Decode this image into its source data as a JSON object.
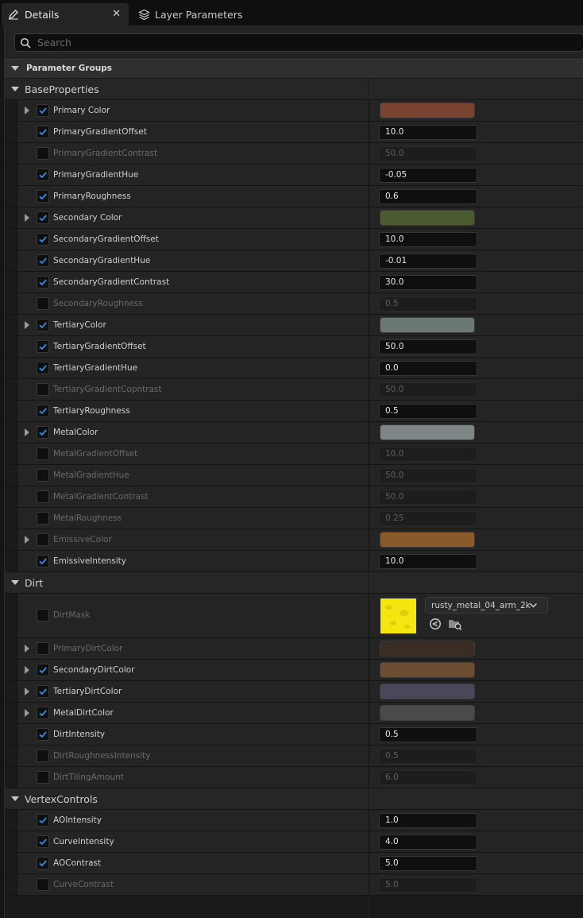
{
  "tabs": [
    {
      "label": "Details",
      "active": true,
      "icon": "pencil-icon"
    },
    {
      "label": "Layer Parameters",
      "active": false,
      "icon": "layers-icon"
    }
  ],
  "search": {
    "placeholder": "Search"
  },
  "parameter_groups_label": "Parameter Groups",
  "colors": {
    "check": "#2f8fe8",
    "enabled_text": "#cfcfcf",
    "disabled_text": "#6a6a6a"
  },
  "groups": [
    {
      "name": "BaseProperties",
      "params": [
        {
          "name": "Primary Color",
          "enabled": true,
          "expandable": true,
          "type": "color",
          "color": "#7a432f"
        },
        {
          "name": "PrimaryGradientOffset",
          "enabled": true,
          "type": "number",
          "value": "10.0"
        },
        {
          "name": "PrimaryGradientContrast",
          "enabled": false,
          "type": "number",
          "value": "50.0"
        },
        {
          "name": "PrimaryGradientHue",
          "enabled": true,
          "type": "number",
          "value": "-0.05"
        },
        {
          "name": "PrimaryRoughness",
          "enabled": true,
          "type": "number",
          "value": "0.6"
        },
        {
          "name": "Secondary Color",
          "enabled": true,
          "expandable": true,
          "type": "color",
          "color": "#4c5a2f"
        },
        {
          "name": "SecondaryGradientOffset",
          "enabled": true,
          "type": "number",
          "value": "10.0"
        },
        {
          "name": "SecondaryGradientHue",
          "enabled": true,
          "type": "number",
          "value": "-0.01"
        },
        {
          "name": "SecondaryGradientContrast",
          "enabled": true,
          "type": "number",
          "value": "30.0"
        },
        {
          "name": "SecondaryRoughness",
          "enabled": false,
          "type": "number",
          "value": "0.5"
        },
        {
          "name": "TertiaryColor",
          "enabled": true,
          "expandable": true,
          "type": "color",
          "color": "#6b7873"
        },
        {
          "name": "TertiaryGradientOffset",
          "enabled": true,
          "type": "number",
          "value": "50.0"
        },
        {
          "name": "TertiaryGradientHue",
          "enabled": true,
          "type": "number",
          "value": "0.0"
        },
        {
          "name": "TertiaryGradientCopntrast",
          "enabled": false,
          "type": "number",
          "value": "50.0"
        },
        {
          "name": "TertiaryRoughness",
          "enabled": true,
          "type": "number",
          "value": "0.5"
        },
        {
          "name": "MetalColor",
          "enabled": true,
          "expandable": true,
          "type": "color",
          "color": "#7e8687"
        },
        {
          "name": "MetalGradientOffset",
          "enabled": false,
          "type": "number",
          "value": "10.0"
        },
        {
          "name": "MetalGradientHue",
          "enabled": false,
          "type": "number",
          "value": "50.0"
        },
        {
          "name": "MetalGradientContrast",
          "enabled": false,
          "type": "number",
          "value": "50.0"
        },
        {
          "name": "MetalRoughness",
          "enabled": false,
          "type": "number",
          "value": "0.25"
        },
        {
          "name": "EmissiveColor",
          "enabled": false,
          "expandable": true,
          "type": "color",
          "color": "#8a5a2c"
        },
        {
          "name": "EmissiveIntensity",
          "enabled": true,
          "type": "number",
          "value": "10.0"
        }
      ]
    },
    {
      "name": "Dirt",
      "params": [
        {
          "name": "DirtMask",
          "enabled": false,
          "type": "texture",
          "asset": "rusty_metal_04_arm_2k",
          "icons": [
            "reset-arrow-icon",
            "browse-folder-icon"
          ]
        },
        {
          "name": "PrimaryDirtColor",
          "enabled": false,
          "expandable": true,
          "type": "color",
          "color": "#3a2e24"
        },
        {
          "name": "SecondaryDirtColor",
          "enabled": true,
          "expandable": true,
          "type": "color",
          "color": "#6e4e32"
        },
        {
          "name": "TertiaryDirtColor",
          "enabled": true,
          "expandable": true,
          "type": "color",
          "color": "#48485a"
        },
        {
          "name": "MetalDirtColor",
          "enabled": true,
          "expandable": true,
          "type": "color",
          "color": "#4a4a4a"
        },
        {
          "name": "DirtIntensity",
          "enabled": true,
          "type": "number",
          "value": "0.5"
        },
        {
          "name": "DirtRoughnessIntensity",
          "enabled": false,
          "type": "number",
          "value": "0.5"
        },
        {
          "name": "DirtTilingAmount",
          "enabled": false,
          "type": "number",
          "value": "6.0"
        }
      ]
    },
    {
      "name": "VertexControls",
      "params": [
        {
          "name": "AOIntensity",
          "enabled": true,
          "type": "number",
          "value": "1.0"
        },
        {
          "name": "CurveIntensity",
          "enabled": true,
          "type": "number",
          "value": "4.0"
        },
        {
          "name": "AOContrast",
          "enabled": true,
          "type": "number",
          "value": "5.0"
        },
        {
          "name": "CurveContrast",
          "enabled": false,
          "type": "number",
          "value": "5.0"
        }
      ]
    }
  ]
}
